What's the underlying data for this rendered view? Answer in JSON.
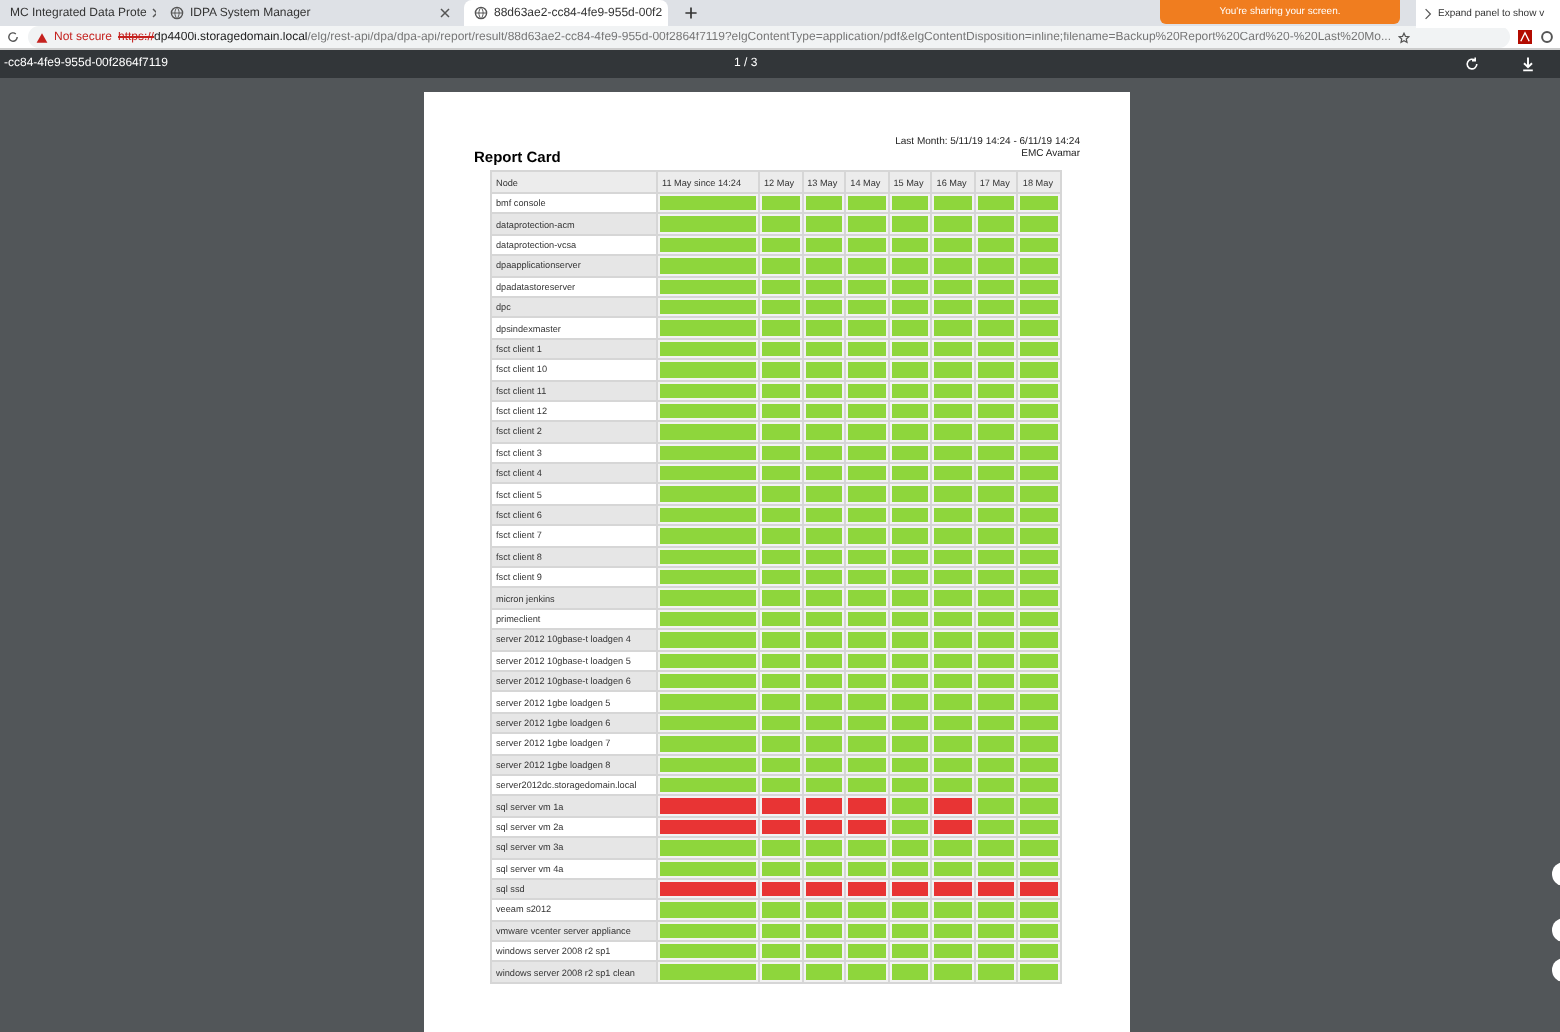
{
  "tabs": [
    {
      "label": "MC Integrated Data Prote",
      "selected": false
    },
    {
      "label": "IDPA System Manager",
      "selected": false
    },
    {
      "label": "88d63ae2-cc84-4fe9-955d-00f2",
      "selected": true
    }
  ],
  "address_bar": {
    "security": "Not secure",
    "scheme": "https://",
    "host": "dp4400i.storagedomain.local",
    "path": "/elg/rest-api/dpa/dpa-api/report/result/88d63ae2-cc84-4fe9-955d-00f2864f7119?elgContentType=application/pdf&elgContentDisposition=inline;filename=Backup%20Report%20Card%20-%20Last%20Mo..."
  },
  "sharing_banner": "You're sharing your screen.",
  "side_panel": "Expand panel to show v",
  "pdf_toolbar": {
    "title": "-cc84-4fe9-955d-00f2864f7119",
    "page": "1 / 3"
  },
  "report": {
    "title": "Report Card",
    "period": "Last Month: 5/11/19 14:24 - 6/11/19 14:24",
    "source": "EMC Avamar",
    "columns": [
      "Node",
      "11 May since 14:24",
      "12 May",
      "13 May",
      "14 May",
      "15 May",
      "16 May",
      "17 May",
      "18 May"
    ],
    "rows": [
      {
        "node": "bmf console",
        "cells": [
          {
            "color": "#8ed63c"
          },
          {
            "color": "#8ed63c"
          },
          {
            "color": "#8ed63c"
          },
          {
            "color": "#8ed63c"
          },
          {
            "color": "#8ed63c"
          },
          {
            "color": "#8ed63c"
          },
          {
            "color": "#8ed63c"
          },
          {
            "color": "#8ed63c"
          }
        ]
      },
      {
        "node": "dataprotection-acm",
        "cells": [
          {
            "color": "#8ed63c"
          },
          {
            "color": "#8ed63c"
          },
          {
            "color": "#8ed63c"
          },
          {
            "color": "#8ed63c"
          },
          {
            "color": "#8ed63c"
          },
          {
            "color": "#8ed63c"
          },
          {
            "color": "#8ed63c"
          },
          {
            "color": "#8ed63c"
          }
        ]
      },
      {
        "node": "dataprotection-vcsa",
        "cells": [
          {
            "color": "#8ed63c"
          },
          {
            "color": "#8ed63c"
          },
          {
            "color": "#8ed63c"
          },
          {
            "color": "#8ed63c"
          },
          {
            "color": "#8ed63c"
          },
          {
            "color": "#8ed63c"
          },
          {
            "color": "#8ed63c"
          },
          {
            "color": "#8ed63c"
          }
        ]
      },
      {
        "node": "dpaapplicationserver",
        "cells": [
          {
            "color": "#8ed63c"
          },
          {
            "color": "#8ed63c"
          },
          {
            "color": "#8ed63c"
          },
          {
            "color": "#8ed63c"
          },
          {
            "color": "#8ed63c"
          },
          {
            "color": "#8ed63c"
          },
          {
            "color": "#8ed63c"
          },
          {
            "color": "#8ed63c"
          }
        ]
      },
      {
        "node": "dpadatastoreserver",
        "cells": [
          {
            "color": "#8ed63c"
          },
          {
            "color": "#8ed63c"
          },
          {
            "color": "#8ed63c"
          },
          {
            "color": "#8ed63c"
          },
          {
            "color": "#8ed63c"
          },
          {
            "color": "#8ed63c"
          },
          {
            "color": "#8ed63c"
          },
          {
            "color": "#8ed63c"
          }
        ]
      },
      {
        "node": "dpc",
        "cells": [
          {
            "color": "#8ed63c"
          },
          {
            "color": "#8ed63c"
          },
          {
            "color": "#8ed63c"
          },
          {
            "color": "#8ed63c"
          },
          {
            "color": "#8ed63c"
          },
          {
            "color": "#8ed63c"
          },
          {
            "color": "#8ed63c"
          },
          {
            "color": "#8ed63c"
          }
        ]
      },
      {
        "node": "dpsindexmaster",
        "cells": [
          {
            "color": "#8ed63c"
          },
          {
            "color": "#8ed63c"
          },
          {
            "color": "#8ed63c"
          },
          {
            "color": "#8ed63c"
          },
          {
            "color": "#8ed63c"
          },
          {
            "color": "#8ed63c"
          },
          {
            "color": "#8ed63c"
          },
          {
            "color": "#8ed63c"
          }
        ]
      },
      {
        "node": "fsct client 1",
        "cells": [
          {
            "color": "#8ed63c"
          },
          {
            "color": "#8ed63c"
          },
          {
            "color": "#8ed63c"
          },
          {
            "color": "#8ed63c"
          },
          {
            "color": "#8ed63c"
          },
          {
            "color": "#8ed63c"
          },
          {
            "color": "#8ed63c"
          },
          {
            "color": "#8ed63c"
          }
        ]
      },
      {
        "node": "fsct client 10",
        "cells": [
          {
            "color": "#8ed63c"
          },
          {
            "color": "#8ed63c"
          },
          {
            "color": "#8ed63c"
          },
          {
            "color": "#8ed63c"
          },
          {
            "color": "#8ed63c"
          },
          {
            "color": "#8ed63c"
          },
          {
            "color": "#8ed63c"
          },
          {
            "color": "#8ed63c"
          }
        ]
      },
      {
        "node": "fsct client 11",
        "cells": [
          {
            "color": "#8ed63c"
          },
          {
            "color": "#8ed63c"
          },
          {
            "color": "#8ed63c"
          },
          {
            "color": "#8ed63c"
          },
          {
            "color": "#8ed63c"
          },
          {
            "color": "#8ed63c"
          },
          {
            "color": "#8ed63c"
          },
          {
            "color": "#8ed63c"
          }
        ]
      },
      {
        "node": "fsct client 12",
        "cells": [
          {
            "color": "#8ed63c"
          },
          {
            "color": "#8ed63c"
          },
          {
            "color": "#8ed63c"
          },
          {
            "color": "#8ed63c"
          },
          {
            "color": "#8ed63c"
          },
          {
            "color": "#8ed63c"
          },
          {
            "color": "#8ed63c"
          },
          {
            "color": "#8ed63c"
          }
        ]
      },
      {
        "node": "fsct client 2",
        "cells": [
          {
            "color": "#8ed63c"
          },
          {
            "color": "#8ed63c"
          },
          {
            "color": "#8ed63c"
          },
          {
            "color": "#8ed63c"
          },
          {
            "color": "#8ed63c"
          },
          {
            "color": "#8ed63c"
          },
          {
            "color": "#8ed63c"
          },
          {
            "color": "#8ed63c"
          }
        ]
      },
      {
        "node": "fsct client 3",
        "cells": [
          {
            "color": "#8ed63c"
          },
          {
            "color": "#8ed63c"
          },
          {
            "color": "#8ed63c"
          },
          {
            "color": "#8ed63c"
          },
          {
            "color": "#8ed63c"
          },
          {
            "color": "#8ed63c"
          },
          {
            "color": "#8ed63c"
          },
          {
            "color": "#8ed63c"
          }
        ]
      },
      {
        "node": "fsct client 4",
        "cells": [
          {
            "color": "#8ed63c"
          },
          {
            "color": "#8ed63c"
          },
          {
            "color": "#8ed63c"
          },
          {
            "color": "#8ed63c"
          },
          {
            "color": "#8ed63c"
          },
          {
            "color": "#8ed63c"
          },
          {
            "color": "#8ed63c"
          },
          {
            "color": "#8ed63c"
          }
        ]
      },
      {
        "node": "fsct client 5",
        "cells": [
          {
            "color": "#8ed63c"
          },
          {
            "color": "#8ed63c"
          },
          {
            "color": "#8ed63c"
          },
          {
            "color": "#8ed63c"
          },
          {
            "color": "#8ed63c"
          },
          {
            "color": "#8ed63c"
          },
          {
            "color": "#8ed63c"
          },
          {
            "color": "#8ed63c"
          }
        ]
      },
      {
        "node": "fsct client 6",
        "cells": [
          {
            "color": "#8ed63c"
          },
          {
            "color": "#8ed63c"
          },
          {
            "color": "#8ed63c"
          },
          {
            "color": "#8ed63c"
          },
          {
            "color": "#8ed63c"
          },
          {
            "color": "#8ed63c"
          },
          {
            "color": "#8ed63c"
          },
          {
            "color": "#8ed63c"
          }
        ]
      },
      {
        "node": "fsct client 7",
        "cells": [
          {
            "color": "#8ed63c"
          },
          {
            "color": "#8ed63c"
          },
          {
            "color": "#8ed63c"
          },
          {
            "color": "#8ed63c"
          },
          {
            "color": "#8ed63c"
          },
          {
            "color": "#8ed63c"
          },
          {
            "color": "#8ed63c"
          },
          {
            "color": "#8ed63c"
          }
        ]
      },
      {
        "node": "fsct client 8",
        "cells": [
          {
            "color": "#8ed63c"
          },
          {
            "color": "#8ed63c"
          },
          {
            "color": "#8ed63c"
          },
          {
            "color": "#8ed63c"
          },
          {
            "color": "#8ed63c"
          },
          {
            "color": "#8ed63c"
          },
          {
            "color": "#8ed63c"
          },
          {
            "color": "#8ed63c"
          }
        ]
      },
      {
        "node": "fsct client 9",
        "cells": [
          {
            "color": "#8ed63c"
          },
          {
            "color": "#8ed63c"
          },
          {
            "color": "#8ed63c"
          },
          {
            "color": "#8ed63c"
          },
          {
            "color": "#8ed63c"
          },
          {
            "color": "#8ed63c"
          },
          {
            "color": "#8ed63c"
          },
          {
            "color": "#8ed63c"
          }
        ]
      },
      {
        "node": "micron jenkins",
        "cells": [
          {
            "color": "#8ed63c"
          },
          {
            "color": "#8ed63c"
          },
          {
            "color": "#8ed63c"
          },
          {
            "color": "#8ed63c"
          },
          {
            "color": "#8ed63c"
          },
          {
            "color": "#8ed63c"
          },
          {
            "color": "#8ed63c"
          },
          {
            "color": "#8ed63c"
          }
        ]
      },
      {
        "node": "primeclient",
        "cells": [
          {
            "color": "#8ed63c"
          },
          {
            "color": "#8ed63c"
          },
          {
            "color": "#8ed63c"
          },
          {
            "color": "#8ed63c"
          },
          {
            "color": "#8ed63c"
          },
          {
            "color": "#8ed63c"
          },
          {
            "color": "#8ed63c"
          },
          {
            "color": "#8ed63c"
          }
        ]
      },
      {
        "node": "server 2012 10gbase-t loadgen 4",
        "cells": [
          {
            "color": "#8ed63c"
          },
          {
            "color": "#8ed63c"
          },
          {
            "color": "#8ed63c"
          },
          {
            "color": "#8ed63c"
          },
          {
            "color": "#8ed63c"
          },
          {
            "color": "#8ed63c"
          },
          {
            "color": "#8ed63c"
          },
          {
            "color": "#8ed63c"
          }
        ]
      },
      {
        "node": "server 2012 10gbase-t loadgen 5",
        "cells": [
          {
            "color": "#8ed63c"
          },
          {
            "color": "#8ed63c"
          },
          {
            "color": "#8ed63c"
          },
          {
            "color": "#8ed63c"
          },
          {
            "color": "#8ed63c"
          },
          {
            "color": "#8ed63c"
          },
          {
            "color": "#8ed63c"
          },
          {
            "color": "#8ed63c"
          }
        ]
      },
      {
        "node": "server 2012 10gbase-t loadgen 6",
        "cells": [
          {
            "color": "#8ed63c"
          },
          {
            "color": "#8ed63c"
          },
          {
            "color": "#8ed63c"
          },
          {
            "color": "#8ed63c"
          },
          {
            "color": "#8ed63c"
          },
          {
            "color": "#8ed63c"
          },
          {
            "color": "#8ed63c"
          },
          {
            "color": "#8ed63c"
          }
        ]
      },
      {
        "node": "server 2012 1gbe loadgen 5",
        "cells": [
          {
            "color": "#8ed63c"
          },
          {
            "color": "#8ed63c"
          },
          {
            "color": "#8ed63c"
          },
          {
            "color": "#8ed63c"
          },
          {
            "color": "#8ed63c"
          },
          {
            "color": "#8ed63c"
          },
          {
            "color": "#8ed63c"
          },
          {
            "color": "#8ed63c"
          }
        ]
      },
      {
        "node": "server 2012 1gbe loadgen 6",
        "cells": [
          {
            "color": "#8ed63c"
          },
          {
            "color": "#8ed63c"
          },
          {
            "color": "#8ed63c"
          },
          {
            "color": "#8ed63c"
          },
          {
            "color": "#8ed63c"
          },
          {
            "color": "#8ed63c"
          },
          {
            "color": "#8ed63c"
          },
          {
            "color": "#8ed63c"
          }
        ]
      },
      {
        "node": "server 2012 1gbe loadgen 7",
        "cells": [
          {
            "color": "#8ed63c"
          },
          {
            "color": "#8ed63c"
          },
          {
            "color": "#8ed63c"
          },
          {
            "color": "#8ed63c"
          },
          {
            "color": "#8ed63c"
          },
          {
            "color": "#8ed63c"
          },
          {
            "color": "#8ed63c"
          },
          {
            "color": "#8ed63c"
          }
        ]
      },
      {
        "node": "server 2012 1gbe loadgen 8",
        "cells": [
          {
            "color": "#8ed63c"
          },
          {
            "color": "#8ed63c"
          },
          {
            "color": "#8ed63c"
          },
          {
            "color": "#8ed63c"
          },
          {
            "color": "#8ed63c"
          },
          {
            "color": "#8ed63c"
          },
          {
            "color": "#8ed63c"
          },
          {
            "color": "#8ed63c"
          }
        ]
      },
      {
        "node": "server2012dc.storagedomain.local",
        "cells": [
          {
            "color": "#8ed63c"
          },
          {
            "color": "#8ed63c"
          },
          {
            "color": "#8ed63c"
          },
          {
            "color": "#8ed63c"
          },
          {
            "color": "#8ed63c"
          },
          {
            "color": "#8ed63c"
          },
          {
            "color": "#8ed63c"
          },
          {
            "color": "#8ed63c"
          }
        ]
      },
      {
        "node": "sql server vm 1a",
        "cells": [
          {
            "color": "#e83434"
          },
          {
            "color": "#e83434"
          },
          {
            "color": "#e83434"
          },
          {
            "color": "#e83434"
          },
          {
            "color": "#8ed63c"
          },
          {
            "color": "#e83434"
          },
          {
            "color": "#8ed63c"
          },
          {
            "color": "#8ed63c"
          }
        ]
      },
      {
        "node": "sql server vm 2a",
        "cells": [
          {
            "color": "#e83434"
          },
          {
            "color": "#e83434"
          },
          {
            "color": "#e83434"
          },
          {
            "color": "#e83434"
          },
          {
            "color": "#8ed63c"
          },
          {
            "color": "#e83434"
          },
          {
            "color": "#8ed63c"
          },
          {
            "color": "#8ed63c"
          }
        ]
      },
      {
        "node": "sql server vm 3a",
        "cells": [
          {
            "color": "#8ed63c"
          },
          {
            "color": "#8ed63c"
          },
          {
            "color": "#8ed63c"
          },
          {
            "color": "#8ed63c"
          },
          {
            "color": "#8ed63c"
          },
          {
            "color": "#8ed63c"
          },
          {
            "color": "#8ed63c"
          },
          {
            "color": "#8ed63c"
          }
        ]
      },
      {
        "node": "sql server vm 4a",
        "cells": [
          {
            "color": "#8ed63c"
          },
          {
            "color": "#8ed63c"
          },
          {
            "color": "#8ed63c"
          },
          {
            "color": "#8ed63c"
          },
          {
            "color": "#8ed63c"
          },
          {
            "color": "#8ed63c"
          },
          {
            "color": "#8ed63c"
          },
          {
            "color": "#8ed63c"
          }
        ]
      },
      {
        "node": "sql ssd",
        "cells": [
          {
            "color": "#e83434"
          },
          {
            "color": "#e83434"
          },
          {
            "color": "#e83434"
          },
          {
            "color": "#e83434"
          },
          {
            "color": "#e83434"
          },
          {
            "color": "#e83434"
          },
          {
            "color": "#e83434"
          },
          {
            "color": "#e83434"
          }
        ]
      },
      {
        "node": "veeam s2012",
        "cells": [
          {
            "color": "#8ed63c"
          },
          {
            "color": "#8ed63c"
          },
          {
            "color": "#8ed63c"
          },
          {
            "color": "#8ed63c"
          },
          {
            "color": "#8ed63c"
          },
          {
            "color": "#8ed63c"
          },
          {
            "color": "#8ed63c"
          },
          {
            "color": "#8ed63c"
          }
        ]
      },
      {
        "node": "vmware vcenter server appliance",
        "cells": [
          {
            "color": "#8ed63c"
          },
          {
            "color": "#8ed63c"
          },
          {
            "color": "#8ed63c"
          },
          {
            "color": "#8ed63c"
          },
          {
            "color": "#8ed63c"
          },
          {
            "color": "#8ed63c"
          },
          {
            "color": "#8ed63c"
          },
          {
            "color": "#8ed63c"
          }
        ]
      },
      {
        "node": "windows server 2008 r2 sp1",
        "cells": [
          {
            "color": "#8ed63c"
          },
          {
            "color": "#8ed63c"
          },
          {
            "color": "#8ed63c"
          },
          {
            "color": "#8ed63c"
          },
          {
            "color": "#8ed63c"
          },
          {
            "color": "#8ed63c"
          },
          {
            "color": "#8ed63c"
          },
          {
            "color": "#8ed63c"
          }
        ]
      },
      {
        "node": "windows server 2008 r2 sp1 clean",
        "cells": [
          {
            "color": "#8ed63c"
          },
          {
            "color": "#8ed63c"
          },
          {
            "color": "#8ed63c"
          },
          {
            "color": "#8ed63c"
          },
          {
            "color": "#8ed63c"
          },
          {
            "color": "#8ed63c"
          },
          {
            "color": "#8ed63c"
          },
          {
            "color": "#8ed63c"
          }
        ]
      }
    ]
  }
}
